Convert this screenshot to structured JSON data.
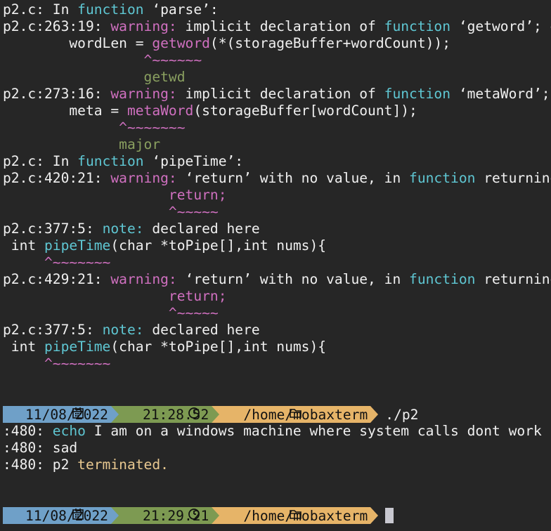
{
  "compiler": {
    "l1": {
      "a": "p2.c: In ",
      "b": "function",
      "c": " ‘parse’:"
    },
    "l2": {
      "a": "p2.c:263:19: ",
      "b": "warning:",
      "c": " implicit declaration of ",
      "d": "function",
      "e": " ‘getword’; did you mean ‘getwd’?"
    },
    "l3": {
      "a": "        wordLen = ",
      "b": "getword",
      "c": "(*(storageBuffer+wordCount));"
    },
    "l4": "                 ^~~~~~~",
    "l5": "                 getwd",
    "l6": {
      "a": "p2.c:273:16: ",
      "b": "warning:",
      "c": " implicit declaration of ",
      "d": "function",
      "e": " ‘metaWord’; did you mean ‘major’?"
    },
    "l7": {
      "a": "        meta = ",
      "b": "metaWord",
      "c": "(storageBuffer[wordCount]);"
    },
    "l8": "              ^~~~~~~~",
    "l9": "              major",
    "l10": {
      "a": "p2.c: In ",
      "b": "function",
      "c": " ‘pipeTime’:"
    },
    "l11": {
      "a": "p2.c:420:21: ",
      "b": "warning:",
      "c": " ‘return’ with no value, in ",
      "d": "function",
      "e": " returning non-void"
    },
    "l12": "                    return;",
    "l13": "                    ^~~~~~",
    "l14": {
      "a": "p2.c:377:5: ",
      "b": "note:",
      "c": " declared here"
    },
    "l15": {
      "a": " int ",
      "b": "pipeTime",
      "c": "(char *toPipe[],int nums){"
    },
    "l16": "     ^~~~~~~~",
    "l17": {
      "a": "p2.c:429:21: ",
      "b": "warning:",
      "c": " ‘return’ with no value, in ",
      "d": "function",
      "e": " returning non-void"
    },
    "l18": "                    return;",
    "l19": "                    ^~~~~~",
    "l20": {
      "a": "p2.c:377:5: ",
      "b": "note:",
      "c": " declared here"
    },
    "l21": {
      "a": " int ",
      "b": "pipeTime",
      "c": "(char *toPipe[],int nums){"
    },
    "l22": "     ^~~~~~~~"
  },
  "prompt1": {
    "date": "11/08/2022",
    "time": "21:28.52",
    "path": "/home/mobaxterm",
    "command": "./p2"
  },
  "output": {
    "o1": {
      "a": ":480: ",
      "b": "echo",
      "c": " I am on a windows machine where system calls dont work"
    },
    "o2": ":480: sad",
    "o3": {
      "a": ":480: p2 ",
      "b": "terminated."
    }
  },
  "prompt2": {
    "date": "11/08/2022",
    "time": "21:29.21",
    "path": "/home/mobaxterm"
  },
  "icons": {
    "date": "calendar-icon",
    "time": "clock-icon",
    "path": "folder-icon"
  },
  "colors": {
    "warning": "#d070c0",
    "keyword": "#5fc7d3",
    "suggestion": "#8aa060",
    "prompt_date": "#6fa0c8",
    "prompt_time": "#7d9a52",
    "prompt_path": "#e6b468"
  }
}
